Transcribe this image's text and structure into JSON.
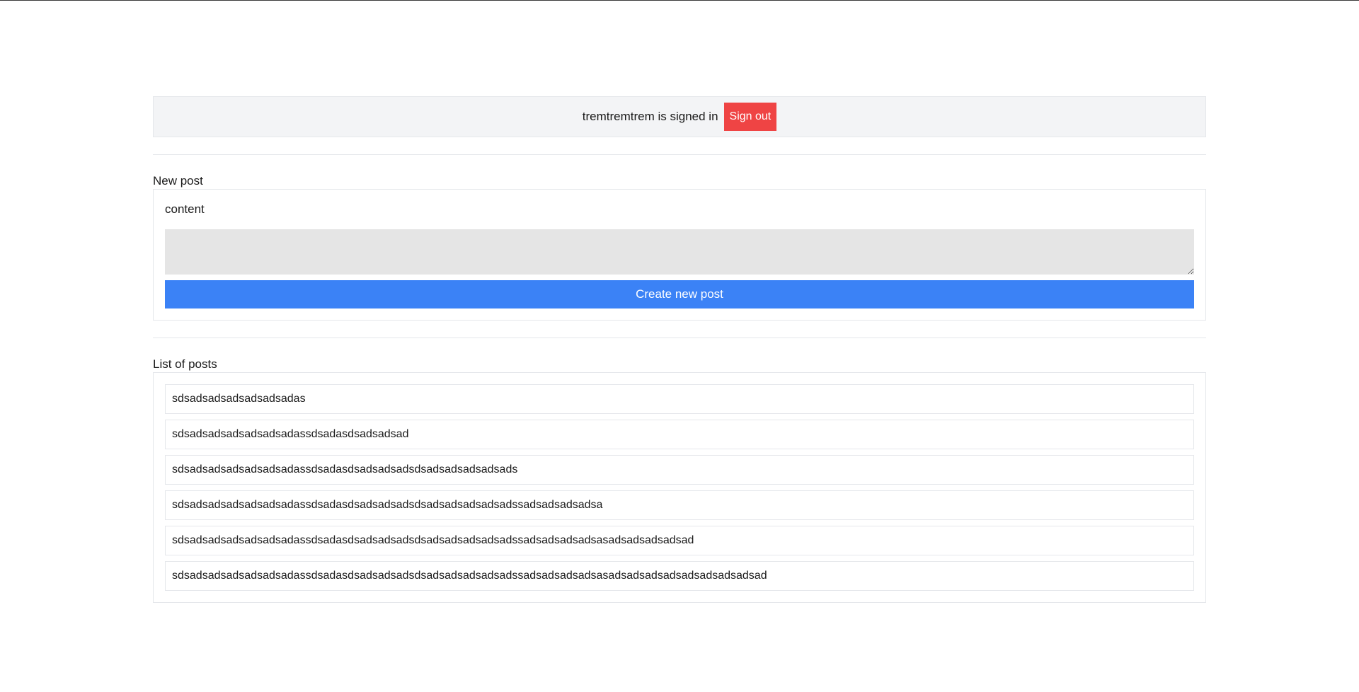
{
  "auth": {
    "signed_in_text": "tremtremtrem is signed in",
    "sign_out_label": "Sign out"
  },
  "new_post": {
    "section_title": "New post",
    "content_label": "content",
    "content_value": "",
    "create_label": "Create new post"
  },
  "posts": {
    "section_title": "List of posts",
    "items": [
      "sdsadsadsadsadsadsadas",
      "sdsadsadsadsadsadsadassdsadasdsadsadsad",
      "sdsadsadsadsadsadsadassdsadasdsadsadsadsdsadsadsadsadsads",
      "sdsadsadsadsadsadsadassdsadasdsadsadsadsdsadsadsadsadsadssadsadsadsadsa",
      "sdsadsadsadsadsadsadassdsadasdsadsadsadsdsadsadsadsadsadssadsadsadsadsasadsadsadsadsad",
      "sdsadsadsadsadsadsadassdsadasdsadsadsadsdsadsadsadsadsadssadsadsadsadsasadsadsadsadsadsadsadsadsad"
    ]
  },
  "colors": {
    "sign_out_bg": "#ef4444",
    "create_bg": "#3b82f6",
    "auth_bar_bg": "#f3f4f6",
    "textarea_bg": "#e5e5e5"
  }
}
